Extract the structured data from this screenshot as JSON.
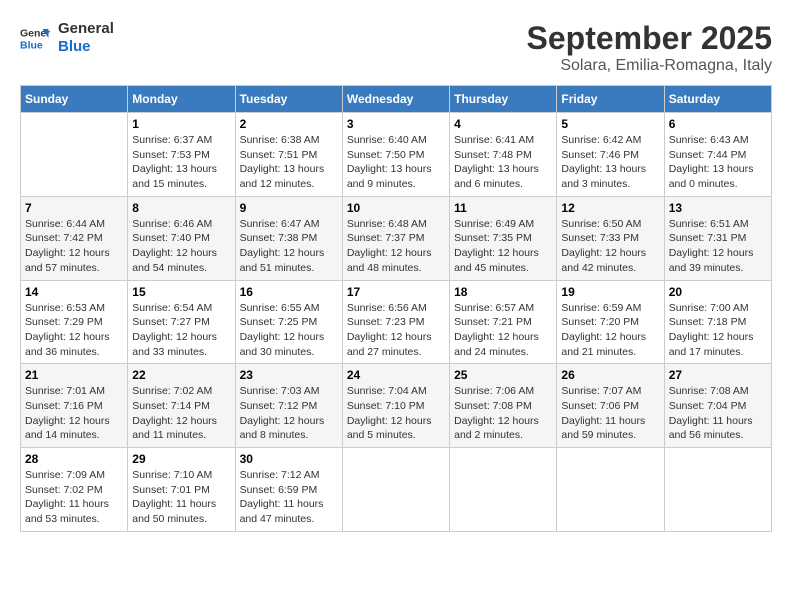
{
  "header": {
    "logo_line1": "General",
    "logo_line2": "Blue",
    "month_year": "September 2025",
    "location": "Solara, Emilia-Romagna, Italy"
  },
  "columns": [
    "Sunday",
    "Monday",
    "Tuesday",
    "Wednesday",
    "Thursday",
    "Friday",
    "Saturday"
  ],
  "weeks": [
    [
      {
        "day": "",
        "info": ""
      },
      {
        "day": "1",
        "info": "Sunrise: 6:37 AM\nSunset: 7:53 PM\nDaylight: 13 hours\nand 15 minutes."
      },
      {
        "day": "2",
        "info": "Sunrise: 6:38 AM\nSunset: 7:51 PM\nDaylight: 13 hours\nand 12 minutes."
      },
      {
        "day": "3",
        "info": "Sunrise: 6:40 AM\nSunset: 7:50 PM\nDaylight: 13 hours\nand 9 minutes."
      },
      {
        "day": "4",
        "info": "Sunrise: 6:41 AM\nSunset: 7:48 PM\nDaylight: 13 hours\nand 6 minutes."
      },
      {
        "day": "5",
        "info": "Sunrise: 6:42 AM\nSunset: 7:46 PM\nDaylight: 13 hours\nand 3 minutes."
      },
      {
        "day": "6",
        "info": "Sunrise: 6:43 AM\nSunset: 7:44 PM\nDaylight: 13 hours\nand 0 minutes."
      }
    ],
    [
      {
        "day": "7",
        "info": "Sunrise: 6:44 AM\nSunset: 7:42 PM\nDaylight: 12 hours\nand 57 minutes."
      },
      {
        "day": "8",
        "info": "Sunrise: 6:46 AM\nSunset: 7:40 PM\nDaylight: 12 hours\nand 54 minutes."
      },
      {
        "day": "9",
        "info": "Sunrise: 6:47 AM\nSunset: 7:38 PM\nDaylight: 12 hours\nand 51 minutes."
      },
      {
        "day": "10",
        "info": "Sunrise: 6:48 AM\nSunset: 7:37 PM\nDaylight: 12 hours\nand 48 minutes."
      },
      {
        "day": "11",
        "info": "Sunrise: 6:49 AM\nSunset: 7:35 PM\nDaylight: 12 hours\nand 45 minutes."
      },
      {
        "day": "12",
        "info": "Sunrise: 6:50 AM\nSunset: 7:33 PM\nDaylight: 12 hours\nand 42 minutes."
      },
      {
        "day": "13",
        "info": "Sunrise: 6:51 AM\nSunset: 7:31 PM\nDaylight: 12 hours\nand 39 minutes."
      }
    ],
    [
      {
        "day": "14",
        "info": "Sunrise: 6:53 AM\nSunset: 7:29 PM\nDaylight: 12 hours\nand 36 minutes."
      },
      {
        "day": "15",
        "info": "Sunrise: 6:54 AM\nSunset: 7:27 PM\nDaylight: 12 hours\nand 33 minutes."
      },
      {
        "day": "16",
        "info": "Sunrise: 6:55 AM\nSunset: 7:25 PM\nDaylight: 12 hours\nand 30 minutes."
      },
      {
        "day": "17",
        "info": "Sunrise: 6:56 AM\nSunset: 7:23 PM\nDaylight: 12 hours\nand 27 minutes."
      },
      {
        "day": "18",
        "info": "Sunrise: 6:57 AM\nSunset: 7:21 PM\nDaylight: 12 hours\nand 24 minutes."
      },
      {
        "day": "19",
        "info": "Sunrise: 6:59 AM\nSunset: 7:20 PM\nDaylight: 12 hours\nand 21 minutes."
      },
      {
        "day": "20",
        "info": "Sunrise: 7:00 AM\nSunset: 7:18 PM\nDaylight: 12 hours\nand 17 minutes."
      }
    ],
    [
      {
        "day": "21",
        "info": "Sunrise: 7:01 AM\nSunset: 7:16 PM\nDaylight: 12 hours\nand 14 minutes."
      },
      {
        "day": "22",
        "info": "Sunrise: 7:02 AM\nSunset: 7:14 PM\nDaylight: 12 hours\nand 11 minutes."
      },
      {
        "day": "23",
        "info": "Sunrise: 7:03 AM\nSunset: 7:12 PM\nDaylight: 12 hours\nand 8 minutes."
      },
      {
        "day": "24",
        "info": "Sunrise: 7:04 AM\nSunset: 7:10 PM\nDaylight: 12 hours\nand 5 minutes."
      },
      {
        "day": "25",
        "info": "Sunrise: 7:06 AM\nSunset: 7:08 PM\nDaylight: 12 hours\nand 2 minutes."
      },
      {
        "day": "26",
        "info": "Sunrise: 7:07 AM\nSunset: 7:06 PM\nDaylight: 11 hours\nand 59 minutes."
      },
      {
        "day": "27",
        "info": "Sunrise: 7:08 AM\nSunset: 7:04 PM\nDaylight: 11 hours\nand 56 minutes."
      }
    ],
    [
      {
        "day": "28",
        "info": "Sunrise: 7:09 AM\nSunset: 7:02 PM\nDaylight: 11 hours\nand 53 minutes."
      },
      {
        "day": "29",
        "info": "Sunrise: 7:10 AM\nSunset: 7:01 PM\nDaylight: 11 hours\nand 50 minutes."
      },
      {
        "day": "30",
        "info": "Sunrise: 7:12 AM\nSunset: 6:59 PM\nDaylight: 11 hours\nand 47 minutes."
      },
      {
        "day": "",
        "info": ""
      },
      {
        "day": "",
        "info": ""
      },
      {
        "day": "",
        "info": ""
      },
      {
        "day": "",
        "info": ""
      }
    ]
  ]
}
